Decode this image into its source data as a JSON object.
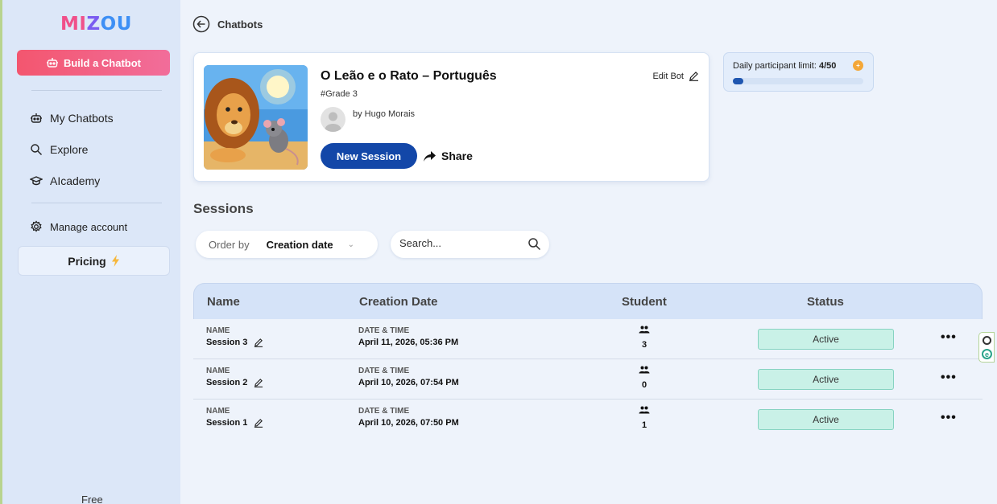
{
  "sidebar": {
    "logo": "MIZOU",
    "build_button": "Build a Chatbot",
    "items": [
      {
        "label": "My Chatbots",
        "icon": "robot-icon"
      },
      {
        "label": "Explore",
        "icon": "search-icon"
      },
      {
        "label": "AIcademy",
        "icon": "graduation-cap-icon"
      },
      {
        "label": "Manage account",
        "icon": "gear-icon"
      }
    ],
    "pricing": "Pricing",
    "plan": "Free"
  },
  "header": {
    "back_label": "Chatbots"
  },
  "bot": {
    "title": "O Leão e o Rato – Português",
    "grade": "#Grade 3",
    "author": "by Hugo Morais",
    "edit_label": "Edit Bot",
    "new_session_label": "New Session",
    "share_label": "Share"
  },
  "limit": {
    "label": "Daily participant limit:",
    "value": "4/50",
    "used": 4,
    "max": 50
  },
  "sessions": {
    "title": "Sessions",
    "order_label": "Order by",
    "order_value": "Creation date",
    "search_placeholder": "Search...",
    "columns": [
      "Name",
      "Creation Date",
      "Student",
      "Status"
    ],
    "rows": [
      {
        "name_label": "NAME",
        "name": "Session 3",
        "date_label": "DATE & TIME",
        "date": "April 11, 2026, 05:36 PM",
        "students": "3",
        "status": "Active"
      },
      {
        "name_label": "NAME",
        "name": "Session 2",
        "date_label": "DATE & TIME",
        "date": "April 10, 2026, 07:54 PM",
        "students": "0",
        "status": "Active"
      },
      {
        "name_label": "NAME",
        "name": "Session 1",
        "date_label": "DATE & TIME",
        "date": "April 10, 2026, 07:50 PM",
        "students": "1",
        "status": "Active"
      }
    ]
  },
  "colors": {
    "accent": "#1347a8",
    "build": "#f3566f",
    "active_bg": "#c9f1e7",
    "sidebar_bg": "#dce7f8"
  }
}
